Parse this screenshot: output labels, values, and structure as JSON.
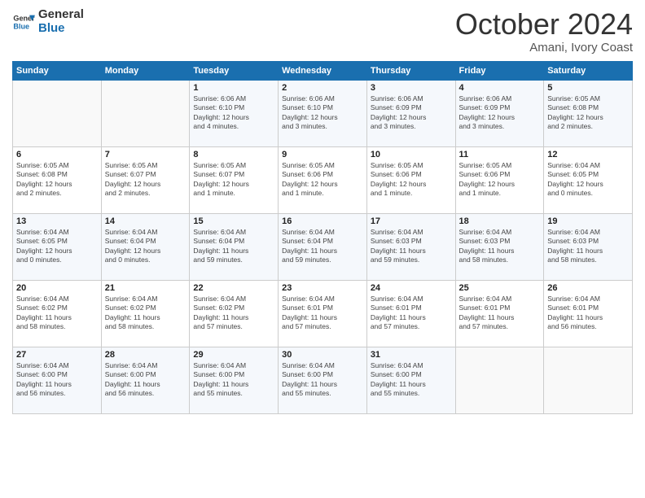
{
  "logo": {
    "line1": "General",
    "line2": "Blue"
  },
  "title": "October 2024",
  "subtitle": "Amani, Ivory Coast",
  "days_header": [
    "Sunday",
    "Monday",
    "Tuesday",
    "Wednesday",
    "Thursday",
    "Friday",
    "Saturday"
  ],
  "weeks": [
    [
      {
        "day": "",
        "detail": ""
      },
      {
        "day": "",
        "detail": ""
      },
      {
        "day": "1",
        "detail": "Sunrise: 6:06 AM\nSunset: 6:10 PM\nDaylight: 12 hours\nand 4 minutes."
      },
      {
        "day": "2",
        "detail": "Sunrise: 6:06 AM\nSunset: 6:10 PM\nDaylight: 12 hours\nand 3 minutes."
      },
      {
        "day": "3",
        "detail": "Sunrise: 6:06 AM\nSunset: 6:09 PM\nDaylight: 12 hours\nand 3 minutes."
      },
      {
        "day": "4",
        "detail": "Sunrise: 6:06 AM\nSunset: 6:09 PM\nDaylight: 12 hours\nand 3 minutes."
      },
      {
        "day": "5",
        "detail": "Sunrise: 6:05 AM\nSunset: 6:08 PM\nDaylight: 12 hours\nand 2 minutes."
      }
    ],
    [
      {
        "day": "6",
        "detail": "Sunrise: 6:05 AM\nSunset: 6:08 PM\nDaylight: 12 hours\nand 2 minutes."
      },
      {
        "day": "7",
        "detail": "Sunrise: 6:05 AM\nSunset: 6:07 PM\nDaylight: 12 hours\nand 2 minutes."
      },
      {
        "day": "8",
        "detail": "Sunrise: 6:05 AM\nSunset: 6:07 PM\nDaylight: 12 hours\nand 1 minute."
      },
      {
        "day": "9",
        "detail": "Sunrise: 6:05 AM\nSunset: 6:06 PM\nDaylight: 12 hours\nand 1 minute."
      },
      {
        "day": "10",
        "detail": "Sunrise: 6:05 AM\nSunset: 6:06 PM\nDaylight: 12 hours\nand 1 minute."
      },
      {
        "day": "11",
        "detail": "Sunrise: 6:05 AM\nSunset: 6:06 PM\nDaylight: 12 hours\nand 1 minute."
      },
      {
        "day": "12",
        "detail": "Sunrise: 6:04 AM\nSunset: 6:05 PM\nDaylight: 12 hours\nand 0 minutes."
      }
    ],
    [
      {
        "day": "13",
        "detail": "Sunrise: 6:04 AM\nSunset: 6:05 PM\nDaylight: 12 hours\nand 0 minutes."
      },
      {
        "day": "14",
        "detail": "Sunrise: 6:04 AM\nSunset: 6:04 PM\nDaylight: 12 hours\nand 0 minutes."
      },
      {
        "day": "15",
        "detail": "Sunrise: 6:04 AM\nSunset: 6:04 PM\nDaylight: 11 hours\nand 59 minutes."
      },
      {
        "day": "16",
        "detail": "Sunrise: 6:04 AM\nSunset: 6:04 PM\nDaylight: 11 hours\nand 59 minutes."
      },
      {
        "day": "17",
        "detail": "Sunrise: 6:04 AM\nSunset: 6:03 PM\nDaylight: 11 hours\nand 59 minutes."
      },
      {
        "day": "18",
        "detail": "Sunrise: 6:04 AM\nSunset: 6:03 PM\nDaylight: 11 hours\nand 58 minutes."
      },
      {
        "day": "19",
        "detail": "Sunrise: 6:04 AM\nSunset: 6:03 PM\nDaylight: 11 hours\nand 58 minutes."
      }
    ],
    [
      {
        "day": "20",
        "detail": "Sunrise: 6:04 AM\nSunset: 6:02 PM\nDaylight: 11 hours\nand 58 minutes."
      },
      {
        "day": "21",
        "detail": "Sunrise: 6:04 AM\nSunset: 6:02 PM\nDaylight: 11 hours\nand 58 minutes."
      },
      {
        "day": "22",
        "detail": "Sunrise: 6:04 AM\nSunset: 6:02 PM\nDaylight: 11 hours\nand 57 minutes."
      },
      {
        "day": "23",
        "detail": "Sunrise: 6:04 AM\nSunset: 6:01 PM\nDaylight: 11 hours\nand 57 minutes."
      },
      {
        "day": "24",
        "detail": "Sunrise: 6:04 AM\nSunset: 6:01 PM\nDaylight: 11 hours\nand 57 minutes."
      },
      {
        "day": "25",
        "detail": "Sunrise: 6:04 AM\nSunset: 6:01 PM\nDaylight: 11 hours\nand 57 minutes."
      },
      {
        "day": "26",
        "detail": "Sunrise: 6:04 AM\nSunset: 6:01 PM\nDaylight: 11 hours\nand 56 minutes."
      }
    ],
    [
      {
        "day": "27",
        "detail": "Sunrise: 6:04 AM\nSunset: 6:00 PM\nDaylight: 11 hours\nand 56 minutes."
      },
      {
        "day": "28",
        "detail": "Sunrise: 6:04 AM\nSunset: 6:00 PM\nDaylight: 11 hours\nand 56 minutes."
      },
      {
        "day": "29",
        "detail": "Sunrise: 6:04 AM\nSunset: 6:00 PM\nDaylight: 11 hours\nand 55 minutes."
      },
      {
        "day": "30",
        "detail": "Sunrise: 6:04 AM\nSunset: 6:00 PM\nDaylight: 11 hours\nand 55 minutes."
      },
      {
        "day": "31",
        "detail": "Sunrise: 6:04 AM\nSunset: 6:00 PM\nDaylight: 11 hours\nand 55 minutes."
      },
      {
        "day": "",
        "detail": ""
      },
      {
        "day": "",
        "detail": ""
      }
    ]
  ]
}
